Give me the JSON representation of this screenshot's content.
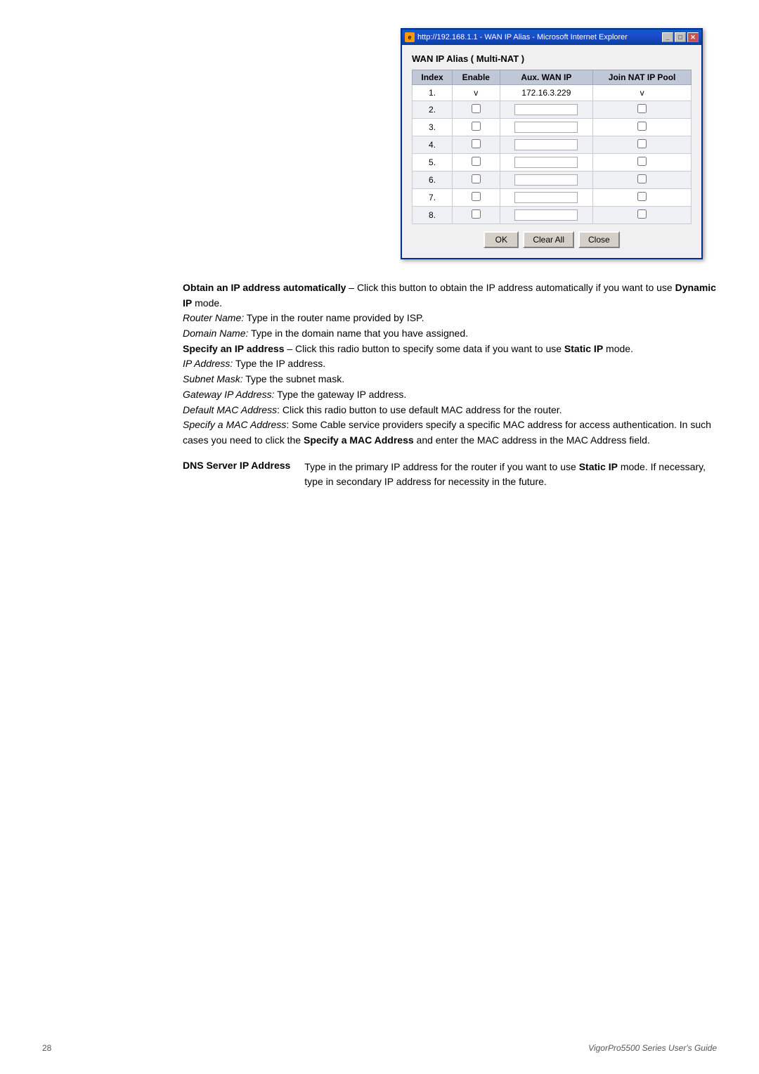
{
  "window": {
    "title": "http://192.168.1.1 - WAN IP Alias - Microsoft Internet Explorer",
    "titlebar_icon": "e",
    "buttons": {
      "minimize": "_",
      "restore": "□",
      "close": "✕"
    }
  },
  "dialog": {
    "title": "WAN IP Alias ( Multi-NAT )",
    "table": {
      "headers": [
        "Index",
        "Enable",
        "Aux. WAN IP",
        "Join NAT IP Pool"
      ],
      "rows": [
        {
          "index": "1.",
          "enable": "v",
          "aux_wan_ip": "172.16.3.229",
          "join_nat": "v",
          "row1": true
        },
        {
          "index": "2.",
          "enable": "",
          "aux_wan_ip": "",
          "join_nat": ""
        },
        {
          "index": "3.",
          "enable": "",
          "aux_wan_ip": "",
          "join_nat": ""
        },
        {
          "index": "4.",
          "enable": "",
          "aux_wan_ip": "",
          "join_nat": ""
        },
        {
          "index": "5.",
          "enable": "",
          "aux_wan_ip": "",
          "join_nat": ""
        },
        {
          "index": "6.",
          "enable": "",
          "aux_wan_ip": "",
          "join_nat": ""
        },
        {
          "index": "7.",
          "enable": "",
          "aux_wan_ip": "",
          "join_nat": ""
        },
        {
          "index": "8.",
          "enable": "",
          "aux_wan_ip": "",
          "join_nat": ""
        }
      ]
    },
    "buttons": {
      "ok": "OK",
      "clear_all": "Clear All",
      "close": "Close"
    }
  },
  "content": {
    "paragraphs": [
      {
        "id": "obtain-ip",
        "text_bold_start": "Obtain an IP address automatically",
        "text_rest": " – Click this button to obtain the IP address automatically if you want to use ",
        "text_bold_mid": "Dynamic IP",
        "text_end": " mode."
      }
    ],
    "lines": [
      "<i>Router Name:</i> Type in the router name provided by ISP.",
      "<i>Domain Name:</i> Type in the domain name that you have assigned.",
      "<b>Specify an IP address</b> – Click this radio button to specify some data if you want to use <b>Static IP</b> mode.",
      "<i>IP Address:</i> Type the IP address.",
      "<i>Subnet Mask:</i> Type the subnet mask.",
      "<i>Gateway IP Address:</i> Type the gateway IP address.",
      "<i>Default MAC Address</i>: Click this radio button to use default MAC address for the router.",
      "<i>Specify a MAC Address</i>: Some Cable service providers specify a specific MAC address for access authentication. In such cases you need to click the <b>Specify a MAC Address</b> and enter the MAC address in the MAC Address field."
    ],
    "dns_section": {
      "label": "DNS Server IP Address",
      "text": "Type in the primary IP address for the router if you want to use <b>Static IP</b> mode. If necessary, type in secondary IP address for necessity in the future."
    }
  },
  "footer": {
    "page_number": "28",
    "guide_name": "VigorPro5500  Series  User's  Guide"
  }
}
